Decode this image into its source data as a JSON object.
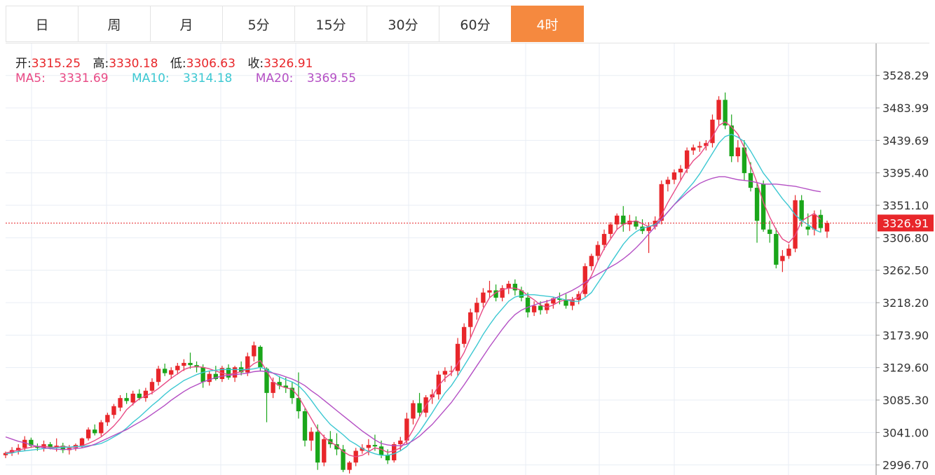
{
  "tabs": [
    {
      "label": "日",
      "active": false
    },
    {
      "label": "周",
      "active": false
    },
    {
      "label": "月",
      "active": false
    },
    {
      "label": "5分",
      "active": false
    },
    {
      "label": "15分",
      "active": false
    },
    {
      "label": "30分",
      "active": false
    },
    {
      "label": "60分",
      "active": false
    },
    {
      "label": "4时",
      "active": true
    }
  ],
  "ohlc": {
    "open_label": "开:",
    "open": "3315.25",
    "high_label": "高:",
    "high": "3330.18",
    "low_label": "低:",
    "low": "3306.63",
    "close_label": "收:",
    "close": "3326.91"
  },
  "ma": {
    "ma5_label": "MA5:",
    "ma5": "3331.69",
    "ma10_label": "MA10:",
    "ma10": "3314.18",
    "ma20_label": "MA20:",
    "ma20": "3369.55"
  },
  "colors": {
    "up": "#e8262a",
    "down": "#1aa61a",
    "ma5": "#e84a85",
    "ma10": "#3cc8d2",
    "ma20": "#b44fc4",
    "active_tab": "#f5893f",
    "grid": "#e8eef4"
  },
  "chart_data": {
    "type": "candlestick",
    "y_ticks": [
      "3528.29",
      "3483.99",
      "3439.69",
      "3395.40",
      "3351.10",
      "3306.80",
      "3262.50",
      "3218.20",
      "3173.90",
      "3129.60",
      "3085.30",
      "3041.00",
      "2996.70"
    ],
    "ylim": [
      2983,
      3572
    ],
    "current_price": "3326.91",
    "ohlc": [
      [
        3010,
        3015,
        3006,
        3013
      ],
      [
        3013,
        3021,
        3009,
        3017
      ],
      [
        3016,
        3025,
        3011,
        3020
      ],
      [
        3020,
        3036,
        3016,
        3031
      ],
      [
        3031,
        3034,
        3020,
        3023
      ],
      [
        3022,
        3026,
        3016,
        3020
      ],
      [
        3020,
        3030,
        3015,
        3025
      ],
      [
        3025,
        3028,
        3018,
        3021
      ],
      [
        3021,
        3033,
        3015,
        3023
      ],
      [
        3023,
        3027,
        3013,
        3017
      ],
      [
        3017,
        3024,
        3011,
        3020
      ],
      [
        3020,
        3026,
        3016,
        3024
      ],
      [
        3022,
        3034,
        3020,
        3033
      ],
      [
        3033,
        3048,
        3030,
        3045
      ],
      [
        3045,
        3052,
        3037,
        3040
      ],
      [
        3040,
        3058,
        3036,
        3055
      ],
      [
        3055,
        3068,
        3050,
        3065
      ],
      [
        3065,
        3080,
        3060,
        3077
      ],
      [
        3075,
        3092,
        3070,
        3088
      ],
      [
        3088,
        3095,
        3080,
        3084
      ],
      [
        3082,
        3098,
        3078,
        3094
      ],
      [
        3094,
        3100,
        3085,
        3088
      ],
      [
        3088,
        3102,
        3083,
        3098
      ],
      [
        3098,
        3115,
        3093,
        3110
      ],
      [
        3110,
        3132,
        3105,
        3128
      ],
      [
        3128,
        3135,
        3118,
        3122
      ],
      [
        3120,
        3130,
        3114,
        3126
      ],
      [
        3126,
        3136,
        3120,
        3132
      ],
      [
        3132,
        3141,
        3125,
        3136
      ],
      [
        3136,
        3150,
        3128,
        3133
      ],
      [
        3133,
        3138,
        3123,
        3130
      ],
      [
        3130,
        3134,
        3102,
        3110
      ],
      [
        3110,
        3125,
        3105,
        3121
      ],
      [
        3121,
        3132,
        3112,
        3114
      ],
      [
        3114,
        3132,
        3110,
        3129
      ],
      [
        3129,
        3134,
        3113,
        3116
      ],
      [
        3116,
        3132,
        3110,
        3130
      ],
      [
        3130,
        3138,
        3119,
        3123
      ],
      [
        3123,
        3150,
        3118,
        3145
      ],
      [
        3145,
        3165,
        3138,
        3160
      ],
      [
        3158,
        3160,
        3124,
        3130
      ],
      [
        3128,
        3130,
        3055,
        3095
      ],
      [
        3095,
        3116,
        3088,
        3110
      ],
      [
        3110,
        3118,
        3100,
        3105
      ],
      [
        3105,
        3116,
        3095,
        3102
      ],
      [
        3102,
        3110,
        3080,
        3088
      ],
      [
        3088,
        3123,
        3060,
        3070
      ],
      [
        3070,
        3074,
        3022,
        3030
      ],
      [
        3030,
        3048,
        3016,
        3042
      ],
      [
        3042,
        3052,
        2990,
        3000
      ],
      [
        3000,
        3038,
        2995,
        3032
      ],
      [
        3032,
        3043,
        3020,
        3025
      ],
      [
        3025,
        3040,
        3010,
        3018
      ],
      [
        3018,
        3024,
        2987,
        2990
      ],
      [
        2990,
        3002,
        2985,
        3000
      ],
      [
        3000,
        3020,
        2995,
        3016
      ],
      [
        3016,
        3025,
        3012,
        3020
      ],
      [
        3020,
        3032,
        3010,
        3024
      ],
      [
        3024,
        3038,
        3016,
        3022
      ],
      [
        3022,
        3030,
        3006,
        3010
      ],
      [
        3010,
        3018,
        2998,
        3003
      ],
      [
        3003,
        3028,
        3000,
        3025
      ],
      [
        3025,
        3035,
        3016,
        3030
      ],
      [
        3030,
        3068,
        3025,
        3060
      ],
      [
        3060,
        3085,
        3052,
        3081
      ],
      [
        3081,
        3095,
        3062,
        3068
      ],
      [
        3068,
        3092,
        3062,
        3089
      ],
      [
        3089,
        3100,
        3080,
        3093
      ],
      [
        3093,
        3125,
        3086,
        3120
      ],
      [
        3120,
        3130,
        3110,
        3125
      ],
      [
        3125,
        3132,
        3118,
        3125
      ],
      [
        3125,
        3170,
        3118,
        3162
      ],
      [
        3162,
        3190,
        3157,
        3185
      ],
      [
        3185,
        3210,
        3170,
        3205
      ],
      [
        3205,
        3225,
        3195,
        3218
      ],
      [
        3218,
        3238,
        3212,
        3232
      ],
      [
        3232,
        3248,
        3225,
        3235
      ],
      [
        3235,
        3243,
        3220,
        3225
      ],
      [
        3225,
        3242,
        3220,
        3238
      ],
      [
        3238,
        3248,
        3230,
        3244
      ],
      [
        3244,
        3250,
        3228,
        3235
      ],
      [
        3235,
        3240,
        3220,
        3225
      ],
      [
        3225,
        3232,
        3198,
        3205
      ],
      [
        3205,
        3220,
        3200,
        3214
      ],
      [
        3214,
        3220,
        3202,
        3208
      ],
      [
        3208,
        3222,
        3203,
        3217
      ],
      [
        3217,
        3226,
        3210,
        3224
      ],
      [
        3224,
        3232,
        3216,
        3222
      ],
      [
        3222,
        3230,
        3210,
        3214
      ],
      [
        3214,
        3226,
        3208,
        3222
      ],
      [
        3222,
        3234,
        3216,
        3230
      ],
      [
        3230,
        3272,
        3226,
        3268
      ],
      [
        3268,
        3285,
        3262,
        3282
      ],
      [
        3282,
        3302,
        3276,
        3297
      ],
      [
        3297,
        3318,
        3290,
        3312
      ],
      [
        3312,
        3328,
        3306,
        3325
      ],
      [
        3325,
        3340,
        3318,
        3337
      ],
      [
        3337,
        3350,
        3315,
        3325
      ],
      [
        3325,
        3338,
        3316,
        3330
      ],
      [
        3330,
        3336,
        3318,
        3322
      ],
      [
        3322,
        3332,
        3312,
        3316
      ],
      [
        3316,
        3328,
        3286,
        3322
      ],
      [
        3322,
        3336,
        3318,
        3330
      ],
      [
        3330,
        3385,
        3325,
        3380
      ],
      [
        3380,
        3390,
        3370,
        3386
      ],
      [
        3386,
        3400,
        3380,
        3396
      ],
      [
        3396,
        3406,
        3385,
        3401
      ],
      [
        3401,
        3430,
        3395,
        3426
      ],
      [
        3426,
        3434,
        3420,
        3430
      ],
      [
        3430,
        3438,
        3424,
        3432
      ],
      [
        3432,
        3440,
        3426,
        3436
      ],
      [
        3436,
        3475,
        3430,
        3468
      ],
      [
        3468,
        3500,
        3460,
        3495
      ],
      [
        3495,
        3505,
        3455,
        3460
      ],
      [
        3460,
        3475,
        3410,
        3418
      ],
      [
        3418,
        3440,
        3410,
        3430
      ],
      [
        3430,
        3440,
        3385,
        3395
      ],
      [
        3395,
        3410,
        3370,
        3375
      ],
      [
        3375,
        3382,
        3300,
        3330
      ],
      [
        3380,
        3385,
        3315,
        3318
      ],
      [
        3318,
        3330,
        3300,
        3312
      ],
      [
        3312,
        3320,
        3265,
        3270
      ],
      [
        3275,
        3290,
        3260,
        3282
      ],
      [
        3282,
        3298,
        3278,
        3292
      ],
      [
        3292,
        3365,
        3287,
        3358
      ],
      [
        3358,
        3365,
        3322,
        3330
      ],
      [
        3322,
        3340,
        3310,
        3318
      ],
      [
        3318,
        3344,
        3310,
        3338
      ],
      [
        3338,
        3345,
        3314,
        3320
      ],
      [
        3315.25,
        3330.18,
        3306.63,
        3326.91
      ]
    ],
    "ma5": [
      3013,
      3015,
      3017,
      3019,
      3021,
      3022,
      3022,
      3021,
      3021,
      3022,
      3021,
      3021,
      3023,
      3026,
      3030,
      3035,
      3042,
      3050,
      3060,
      3072,
      3080,
      3087,
      3091,
      3095,
      3101,
      3108,
      3115,
      3121,
      3127,
      3130,
      3131,
      3130,
      3128,
      3125,
      3122,
      3120,
      3122,
      3124,
      3128,
      3135,
      3139,
      3125,
      3110,
      3105,
      3102,
      3100,
      3090,
      3075,
      3060,
      3045,
      3035,
      3028,
      3023,
      3015,
      3010,
      3008,
      3010,
      3015,
      3020,
      3018,
      3014,
      3016,
      3020,
      3030,
      3045,
      3062,
      3078,
      3090,
      3105,
      3115,
      3122,
      3135,
      3150,
      3170,
      3190,
      3210,
      3225,
      3232,
      3236,
      3238,
      3238,
      3235,
      3228,
      3222,
      3215,
      3212,
      3215,
      3220,
      3222,
      3222,
      3226,
      3240,
      3255,
      3275,
      3292,
      3305,
      3318,
      3325,
      3328,
      3330,
      3326,
      3322,
      3324,
      3338,
      3355,
      3370,
      3385,
      3400,
      3412,
      3420,
      3432,
      3445,
      3460,
      3465,
      3458,
      3448,
      3430,
      3405,
      3382,
      3355,
      3335,
      3318,
      3305,
      3300,
      3310,
      3330,
      3335,
      3340,
      3331.69
    ],
    "ma10": [
      3012,
      3013,
      3015,
      3016,
      3017,
      3018,
      3019,
      3020,
      3020,
      3021,
      3021,
      3022,
      3022,
      3023,
      3024,
      3026,
      3030,
      3035,
      3040,
      3047,
      3055,
      3062,
      3070,
      3078,
      3085,
      3093,
      3100,
      3106,
      3112,
      3116,
      3120,
      3123,
      3125,
      3126,
      3127,
      3127,
      3127,
      3127,
      3127,
      3128,
      3130,
      3127,
      3122,
      3117,
      3113,
      3110,
      3105,
      3096,
      3085,
      3073,
      3062,
      3052,
      3045,
      3038,
      3030,
      3025,
      3019,
      3015,
      3012,
      3010,
      3010,
      3012,
      3016,
      3022,
      3032,
      3042,
      3055,
      3068,
      3082,
      3095,
      3105,
      3118,
      3132,
      3146,
      3160,
      3175,
      3188,
      3200,
      3210,
      3220,
      3226,
      3228,
      3229,
      3229,
      3228,
      3227,
      3226,
      3224,
      3222,
      3220,
      3220,
      3225,
      3232,
      3245,
      3258,
      3272,
      3285,
      3298,
      3308,
      3315,
      3320,
      3322,
      3325,
      3332,
      3342,
      3352,
      3362,
      3372,
      3382,
      3394,
      3408,
      3422,
      3436,
      3445,
      3448,
      3444,
      3438,
      3425,
      3410,
      3395,
      3384,
      3372,
      3360,
      3350,
      3338,
      3330,
      3325,
      3318,
      3314.18
    ],
    "ma20": [
      3035,
      3032,
      3029,
      3027,
      3024,
      3022,
      3020,
      3019,
      3018,
      3018,
      3018,
      3019,
      3020,
      3022,
      3025,
      3029,
      3033,
      3037,
      3041,
      3045,
      3050,
      3055,
      3060,
      3066,
      3072,
      3078,
      3085,
      3091,
      3097,
      3102,
      3106,
      3110,
      3113,
      3116,
      3118,
      3119,
      3120,
      3121,
      3122,
      3124,
      3125,
      3124,
      3122,
      3120,
      3117,
      3114,
      3110,
      3105,
      3098,
      3092,
      3085,
      3078,
      3071,
      3064,
      3057,
      3050,
      3043,
      3037,
      3031,
      3026,
      3024,
      3023,
      3023,
      3025,
      3030,
      3036,
      3044,
      3052,
      3062,
      3072,
      3082,
      3094,
      3106,
      3119,
      3132,
      3145,
      3158,
      3170,
      3182,
      3193,
      3202,
      3208,
      3212,
      3215,
      3218,
      3220,
      3223,
      3227,
      3231,
      3235,
      3240,
      3246,
      3252,
      3257,
      3262,
      3267,
      3272,
      3278,
      3285,
      3293,
      3302,
      3312,
      3322,
      3332,
      3342,
      3352,
      3360,
      3368,
      3375,
      3381,
      3385,
      3388,
      3390,
      3390,
      3388,
      3386,
      3385,
      3384,
      3382,
      3380,
      3380,
      3380,
      3379,
      3378,
      3377,
      3375,
      3373,
      3371,
      3369.55
    ]
  }
}
